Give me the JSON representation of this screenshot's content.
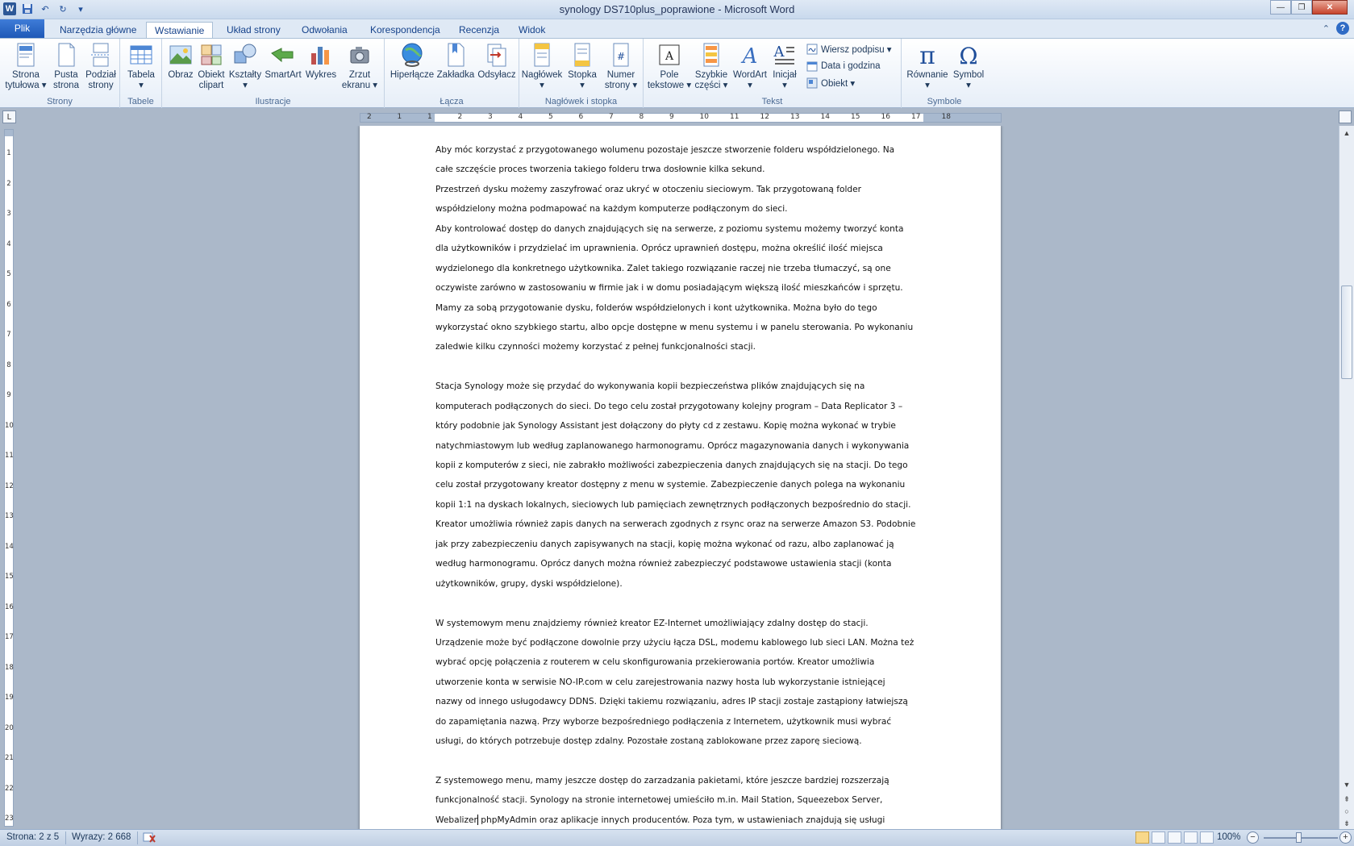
{
  "window": {
    "title": "synology DS710plus_poprawione  -  Microsoft Word",
    "quick_access": [
      "save-icon",
      "undo-icon",
      "redo-icon",
      "customize-icon"
    ]
  },
  "tabs": [
    {
      "label": "Plik"
    },
    {
      "label": "Narzędzia główne"
    },
    {
      "label": "Wstawianie"
    },
    {
      "label": "Układ strony"
    },
    {
      "label": "Odwołania"
    },
    {
      "label": "Korespondencja"
    },
    {
      "label": "Recenzja"
    },
    {
      "label": "Widok"
    }
  ],
  "ribbon": {
    "groups": {
      "strony": "Strony",
      "tabele": "Tabele",
      "ilustracje": "Ilustracje",
      "lacza": "Łącza",
      "naglowek": "Nagłówek i stopka",
      "tekst": "Tekst",
      "symbole": "Symbole"
    },
    "buttons": {
      "strona_tytulowa": [
        "Strona",
        "tytułowa ▾"
      ],
      "pusta_strona": [
        "Pusta",
        "strona"
      ],
      "podzial_strony": [
        "Podział",
        "strony"
      ],
      "tabela": [
        "Tabela",
        "▾"
      ],
      "obraz": [
        "Obraz",
        ""
      ],
      "obiekt_clipart": [
        "Obiekt",
        "clipart"
      ],
      "ksztalty": [
        "Kształty",
        "▾"
      ],
      "smartart": [
        "SmartArt",
        ""
      ],
      "wykres": [
        "Wykres",
        ""
      ],
      "zrzut_ekranu": [
        "Zrzut",
        "ekranu ▾"
      ],
      "hiperlacze": [
        "Hiperłącze",
        ""
      ],
      "zakladka": [
        "Zakładka",
        ""
      ],
      "odsylacz": [
        "Odsyłacz",
        ""
      ],
      "naglowek": [
        "Nagłówek",
        "▾"
      ],
      "stopka": [
        "Stopka",
        "▾"
      ],
      "numer_strony": [
        "Numer",
        "strony ▾"
      ],
      "pole_tekstowe": [
        "Pole",
        "tekstowe ▾"
      ],
      "szybkie_czesci": [
        "Szybkie",
        "części ▾"
      ],
      "wordart": [
        "WordArt",
        "▾"
      ],
      "inicjal": [
        "Inicjał",
        "▾"
      ],
      "rownanie": [
        "Równanie",
        "▾"
      ],
      "symbol": [
        "Symbol",
        "▾"
      ]
    },
    "small_buttons": {
      "wiersz_podpisu": "Wiersz podpisu ▾",
      "data_i_godzina": "Data i godzina",
      "obiekt": "Obiekt ▾"
    }
  },
  "ruler": {
    "numbers": [
      "2",
      "1",
      "1",
      "2",
      "3",
      "4",
      "5",
      "6",
      "7",
      "8",
      "9",
      "10",
      "11",
      "12",
      "13",
      "14",
      "15",
      "16",
      "17",
      "18"
    ],
    "vertical_numbers": [
      "1",
      "2",
      "3",
      "4",
      "5",
      "6",
      "7",
      "8",
      "9",
      "10",
      "11",
      "12",
      "13",
      "14",
      "15",
      "16",
      "17",
      "18",
      "19",
      "20",
      "21",
      "22",
      "23"
    ]
  },
  "document": {
    "paragraphs": [
      [
        "Aby móc korzystać z przygotowanego wolumenu pozostaje jeszcze stworzenie folderu współdzielonego. Na",
        "całe szczęście proces tworzenia takiego folderu trwa dosłownie kilka sekund."
      ],
      [
        "Przestrzeń dysku możemy zaszyfrować oraz ukryć w otoczeniu sieciowym. Tak przygotowaną folder",
        "współdzielony można podmapować na każdym komputerze podłączonym do sieci."
      ],
      [
        "Aby kontrolować dostęp do danych znajdujących się na serwerze, z poziomu systemu możemy tworzyć konta",
        "dla użytkowników  i przydzielać im uprawnienia. Oprócz uprawnień dostępu, można określić ilość miejsca",
        "wydzielonego dla konkretnego użytkownika. Zalet takiego rozwiązanie raczej nie trzeba tłumaczyć, są one",
        "oczywiste zarówno w zastosowaniu  w firmie jak i w domu posiadającym większą ilość mieszkańców i sprzętu.",
        "Mamy za sobą przygotowanie dysku, folderów współdzielonych i kont użytkownika. Można było do tego",
        "wykorzystać okno szybkiego startu, albo opcje dostępne w menu systemu i w panelu sterowania. Po wykonaniu",
        "zaledwie kilku czynności możemy korzystać z pełnej funkcjonalności stacji."
      ],
      [
        "Stacja Synology może się przydać do wykonywania  kopii bezpieczeństwa plików znajdujących się na",
        "komputerach podłączonych do sieci. Do tego celu został przygotowany kolejny program – Data Replicator 3 –",
        "który podobnie jak Synology Assistant jest dołączony do płyty cd z zestawu. Kopię można wykonać w trybie",
        "natychmiastowym  lub według zaplanowanego harmonogramu. Oprócz magazynowania  danych i wykonywania",
        "kopii z komputerów z sieci, nie zabrakło możliwości zabezpieczenia danych znajdujących się na stacji. Do tego",
        "celu został przygotowany kreator dostępny z menu w systemie. Zabezpieczenie danych polega na wykonaniu",
        "kopii 1:1 na dyskach lokalnych, sieciowych lub pamięciach zewnętrznych podłączonych bezpośrednio do stacji.",
        "Kreator umożliwia również zapis danych na serwerach zgodnych z rsync oraz na serwerze Amazon S3. Podobnie",
        "jak przy zabezpieczeniu danych zapisywanych na stacji, kopię można wykonać od razu, albo zaplanować ją",
        "według harmonogramu. Oprócz danych można również zabezpieczyć podstawowe ustawienia stacji (konta",
        "użytkowników, grupy, dyski współdzielone)."
      ],
      [
        "W systemowym menu znajdziemy również kreator EZ-Internet umożliwiający  zdalny dostęp do stacji.",
        "Urządzenie może być podłączone dowolnie przy użyciu łącza DSL, modemu kablowego lub sieci LAN. Można też",
        "wybrać opcję połączenia z routerem w celu skonfigurowania przekierowania portów. Kreator umożliwia",
        "utworzenie konta w serwisie NO-IP.com w celu zarejestrowania nazwy hosta lub wykorzystanie istniejącej",
        "nazwy od innego usługodawcy DDNS. Dzięki takiemu rozwiązaniu, adres IP stacji zostaje zastąpiony łatwiejszą",
        "do zapamiętania nazwą. Przy wyborze bezpośredniego podłączenia z Internetem, użytkownik musi wybrać",
        "usługi, do których potrzebuje dostęp zdalny. Pozostałe zostaną zablokowane przez zaporę sieciową."
      ],
      [
        "Z systemowego menu, mamy jeszcze dostęp do zarzadzania pakietami, które jeszcze bardziej rozszerzają",
        "funkcjonalność stacji. Synology na stronie internetowej umieściło m.in. Mail Station, Squeezebox Server,"
      ]
    ],
    "last_line_before_cursor": "Webalizer",
    "last_line_after_cursor": " phpMyAdmin oraz aplikacje innych producentów. Poza tym, w ustawieniach znajdują się usługi"
  },
  "status": {
    "page": "Strona: 2 z 5",
    "words": "Wyrazy: 2 668",
    "zoom": "100%",
    "zoom_level_percent": 100
  }
}
